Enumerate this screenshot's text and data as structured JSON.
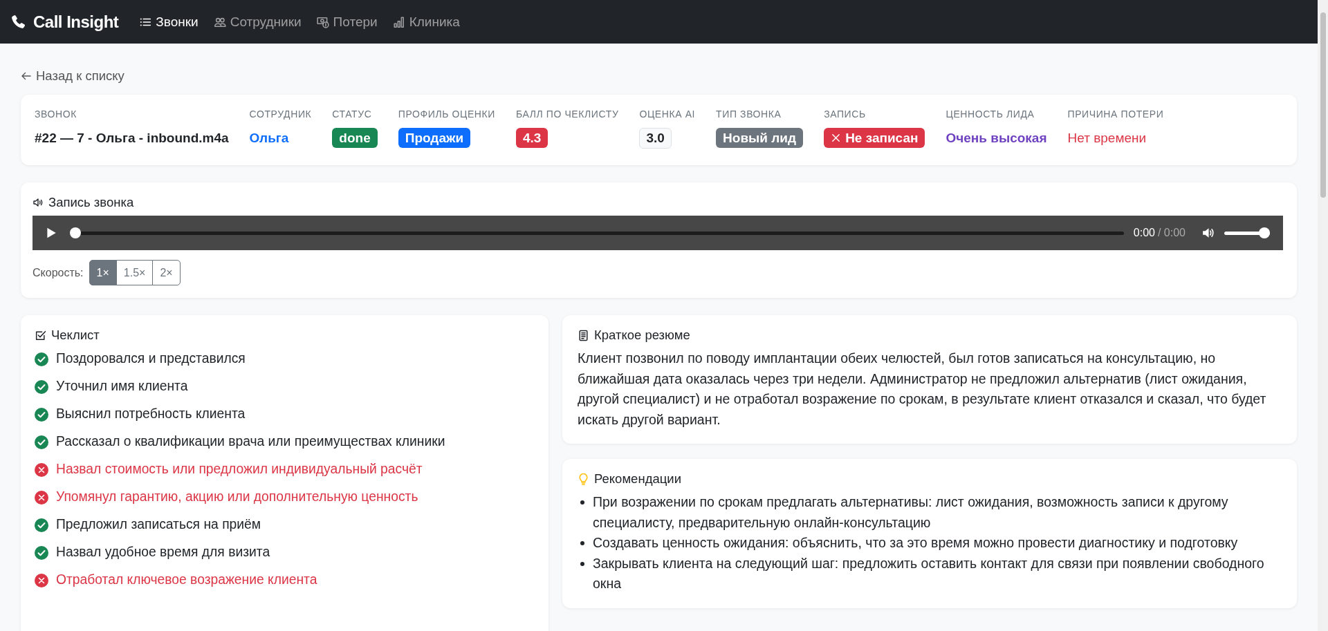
{
  "nav": {
    "brand": "Call Insight",
    "links": [
      {
        "label": "Звонки",
        "selected": true
      },
      {
        "label": "Сотрудники",
        "selected": false
      },
      {
        "label": "Потери",
        "selected": false
      },
      {
        "label": "Клиника",
        "selected": false
      }
    ]
  },
  "back_link": "Назад к списку",
  "call_info": [
    {
      "label": "ЗВОНОК",
      "value": "#22 — 7 - Ольга - inbound.m4a",
      "kind": "text"
    },
    {
      "label": "СОТРУДНИК",
      "value": "Ольга",
      "kind": "link"
    },
    {
      "label": "СТАТУС",
      "value": "done",
      "kind": "badge",
      "color": "#198754"
    },
    {
      "label": "ПРОФИЛЬ ОЦЕНКИ",
      "value": "Продажи",
      "kind": "badge",
      "color": "#0d6efd"
    },
    {
      "label": "БАЛЛ ПО ЧЕКЛИСТУ",
      "value": "4.3",
      "kind": "badge",
      "color": "#dc3545"
    },
    {
      "label": "ОЦЕНКА AI",
      "value": "3.0",
      "kind": "outline-badge"
    },
    {
      "label": "ТИП ЗВОНКА",
      "value": "Новый лид",
      "kind": "badge",
      "color": "#6c757d"
    },
    {
      "label": "ЗАПИСЬ",
      "value": "Не записан",
      "kind": "icon-badge",
      "color": "#dc3545"
    },
    {
      "label": "ЦЕННОСТЬ ЛИДА",
      "value": "Очень высокая",
      "kind": "colored-text",
      "color": "#6f42c1"
    },
    {
      "label": "ПРИЧИНА ПОТЕРИ",
      "value": "Нет времени",
      "kind": "colored-text",
      "color": "#dc3545"
    }
  ],
  "recording": {
    "title": "Запись звонка",
    "current_time": "0:00",
    "total_time": "/ 0:00",
    "progress": {
      "level": 0
    },
    "volume": {
      "level": 1
    },
    "speed": {
      "label": "Скорость:",
      "options": [
        {
          "label": "1×",
          "selected": true
        },
        {
          "label": "1.5×",
          "selected": false
        },
        {
          "label": "2×",
          "selected": false
        }
      ]
    }
  },
  "checklist": {
    "title": "Чеклист",
    "items": [
      {
        "text": "Поздоровался и представился",
        "passed": true
      },
      {
        "text": "Уточнил имя клиента",
        "passed": true
      },
      {
        "text": "Выяснил потребность клиента",
        "passed": true
      },
      {
        "text": "Рассказал о квалификации врача или преимуществах клиники",
        "passed": true
      },
      {
        "text": "Назвал стоимость или предложил индивидуальный расчёт",
        "passed": false
      },
      {
        "text": "Упомянул гарантию, акцию или дополнительную ценность",
        "passed": false
      },
      {
        "text": "Предложил записаться на приём",
        "passed": true
      },
      {
        "text": "Назвал удобное время для визита",
        "passed": true
      },
      {
        "text": "Отработал ключевое возражение клиента",
        "passed": false
      }
    ]
  },
  "summary": {
    "title": "Краткое резюме",
    "text": "Клиент позвонил по поводу имплантации обеих челюстей, был готов записаться на консультацию, но ближайшая дата оказалась через три недели. Администратор не предложил альтернатив (лист ожидания, другой специалист) и не отработал возражение по срокам, в результате клиент отказался и сказал, что будет искать другой вариант."
  },
  "recommendations": {
    "title": "Рекомендации",
    "items": [
      "При возражении по срокам предлагать альтернативы: лист ожидания, возможность записи к другому специалисту, предварительную онлайн-консультацию",
      "Создавать ценность ожидания: объяснить, что за это время можно провести диагностику и подготовку",
      "Закрывать клиента на следующий шаг: предложить оставить контакт для связи при появлении свободного окна"
    ]
  }
}
